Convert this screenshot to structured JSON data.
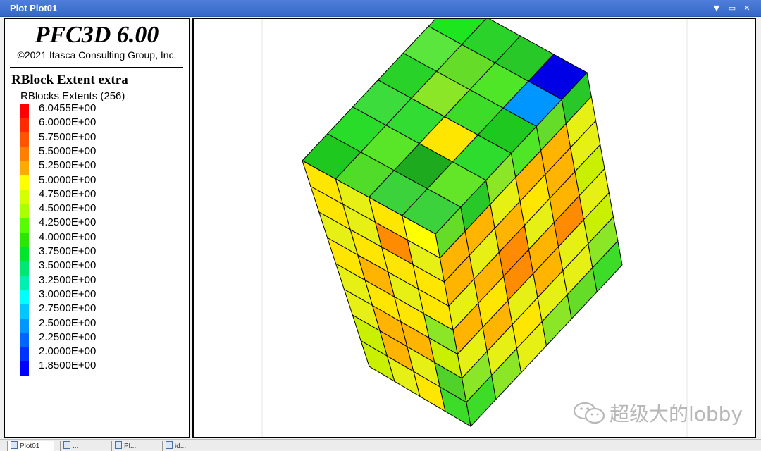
{
  "window": {
    "title": "Plot Plot01",
    "controls": [
      "dropdown-arrow-icon",
      "restore-icon",
      "close-icon"
    ]
  },
  "legend": {
    "app_name": "PFC3D 6.00",
    "copyright": "©2021 Itasca Consulting Group, Inc.",
    "title": "RBlock Extent extra",
    "subtitle": "RBlocks Extents (256)",
    "scale": [
      {
        "label": "6.0455E+00",
        "color": "#ff0000"
      },
      {
        "label": "6.0000E+00",
        "color": "#ff2a00"
      },
      {
        "label": "5.7500E+00",
        "color": "#ff5500"
      },
      {
        "label": "5.5000E+00",
        "color": "#ff8000"
      },
      {
        "label": "5.2500E+00",
        "color": "#ffaa00"
      },
      {
        "label": "5.0000E+00",
        "color": "#ffff00"
      },
      {
        "label": "4.7500E+00",
        "color": "#d4ff00"
      },
      {
        "label": "4.5000E+00",
        "color": "#aaff00"
      },
      {
        "label": "4.2500E+00",
        "color": "#55ff00"
      },
      {
        "label": "4.0000E+00",
        "color": "#2ae600"
      },
      {
        "label": "3.7500E+00",
        "color": "#00e62a"
      },
      {
        "label": "3.5000E+00",
        "color": "#00e673"
      },
      {
        "label": "3.2500E+00",
        "color": "#00f0b4"
      },
      {
        "label": "3.0000E+00",
        "color": "#00ffff"
      },
      {
        "label": "2.7500E+00",
        "color": "#00c8ff"
      },
      {
        "label": "2.5000E+00",
        "color": "#0096ff"
      },
      {
        "label": "2.2500E+00",
        "color": "#0064ff"
      },
      {
        "label": "2.0000E+00",
        "color": "#0032ff"
      },
      {
        "label": "1.8500E+00",
        "color": "#0000ff"
      }
    ]
  },
  "plot": {
    "description_icon": "3d-block-model",
    "columns": 4,
    "rows": 8,
    "depth_columns": 6,
    "top_colors": [
      [
        "#1ec81e",
        "#2adc2a",
        "#3cdc3c",
        "#28d228",
        "#5ae63c",
        "#1ee61e"
      ],
      [
        "#50dc28",
        "#5ae628",
        "#32dc32",
        "#8ce628",
        "#64dc28",
        "#2ad22a"
      ],
      [
        "#3cd23c",
        "#1eaa1e",
        "#ffe600",
        "#3cdc28",
        "#50e628",
        "#28c828"
      ],
      [
        "#3cd23c",
        "#64e628",
        "#2ddc2d",
        "#1ec81e",
        "#0096ff",
        "#0000e6"
      ]
    ],
    "front_colors": [
      [
        "#ffe600",
        "#e6f014",
        "#ffe600",
        "#ffff00"
      ],
      [
        "#ffe600",
        "#e6f014",
        "#ff8c00",
        "#e6f014"
      ],
      [
        "#e6f014",
        "#ffe600",
        "#ffe600",
        "#ffe600"
      ],
      [
        "#ffe600",
        "#ffb400",
        "#e6f014",
        "#ffe600"
      ],
      [
        "#e6f014",
        "#ffe600",
        "#ffe600",
        "#8ce628"
      ],
      [
        "#e6f014",
        "#ffb400",
        "#ffb400",
        "#c8f000"
      ],
      [
        "#c8f000",
        "#ffb400",
        "#e6f014",
        "#50d228"
      ],
      [
        "#c8f000",
        "#e6f014",
        "#ffe600",
        "#3cdc28"
      ]
    ],
    "side_colors": [
      [
        "#64dc28",
        "#28c828",
        "#8ce628",
        "#50e628",
        "#64dc28",
        "#28c828"
      ],
      [
        "#ffb400",
        "#ffb400",
        "#e6f014",
        "#ffb400",
        "#ffb400",
        "#e6f014"
      ],
      [
        "#ffb400",
        "#e6f014",
        "#ffb400",
        "#ffe600",
        "#ffb400",
        "#e6f014"
      ],
      [
        "#e6f014",
        "#ffb400",
        "#ff8c00",
        "#e6f014",
        "#ffb400",
        "#c8f000"
      ],
      [
        "#ffb400",
        "#ffe600",
        "#ff8c00",
        "#ffb400",
        "#ff8c00",
        "#e6f014"
      ],
      [
        "#e6f014",
        "#ffb400",
        "#e6f014",
        "#ffb400",
        "#e6f014",
        "#c8f000"
      ],
      [
        "#8ce628",
        "#e6f014",
        "#ffe600",
        "#e6f014",
        "#e6f014",
        "#8ce628"
      ],
      [
        "#3cdc28",
        "#8ce628",
        "#e6f014",
        "#8ce628",
        "#64dc28",
        "#3cdc28"
      ]
    ]
  },
  "watermark": {
    "text": "超级大的lobby"
  },
  "bottom_tabs": [
    {
      "label": "Plot01"
    },
    {
      "label": "..."
    },
    {
      "label": "Pl..."
    },
    {
      "label": "id..."
    }
  ]
}
